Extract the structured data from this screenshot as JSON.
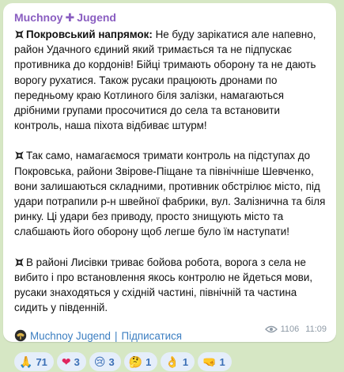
{
  "message": {
    "channel_name_left": "Muchnoy",
    "channel_name_right": "Jugend",
    "paragraphs": [
      {
        "heading": "Покровський напрямок:",
        "text": " Не буду зарікатися але напевно, район Удачного єдиний який тримається та не підпускає противника до кордонів! Бійці тримають оборону та не дають ворогу рухатися. Також русаки працюють дронами по передньому краю Котлиного біля залізки, намагаються дрібними групами просочитися до села та встановити контроль, наша піхота відбиває штурм!"
      },
      {
        "heading": "",
        "text": "Так само, намагаємося тримати контроль на підступах до Покровська, райони Звірове-Піщане та північніше Шевченко, вони залишаються складними, противник обстрілює місто, під удари потрапили р-н швейної фабрики, вул. Залізнична та біля ринку. Ці удари без приводу, просто знищують місто та слабшають його оборону щоб легше було їм наступати!"
      },
      {
        "heading": "",
        "text": "В районі Лисівки триває бойова робота, ворога з села не вибито і про встановлення якось контролю не йдеться мови, русаки знаходяться у східній частині, північній та частина сидить у південній."
      }
    ],
    "signature": {
      "link_text": "Muchnoy Jugend",
      "separator": "|",
      "subscribe_text": "Підписатися"
    },
    "reactions": [
      {
        "emoji": "🙏",
        "count": "71"
      },
      {
        "emoji": "❤",
        "count": "3"
      },
      {
        "emoji": "😢",
        "count": "3"
      },
      {
        "emoji": "🤔",
        "count": "1"
      },
      {
        "emoji": "👌",
        "count": "1"
      },
      {
        "emoji": "🤜",
        "count": "1"
      }
    ],
    "views": "1106",
    "time": "11:09"
  },
  "colors": {
    "background": "#d6e7c4",
    "channel_name": "#8a5ec1",
    "link": "#3b7ec1",
    "reaction_bg": "#e5eefa"
  }
}
